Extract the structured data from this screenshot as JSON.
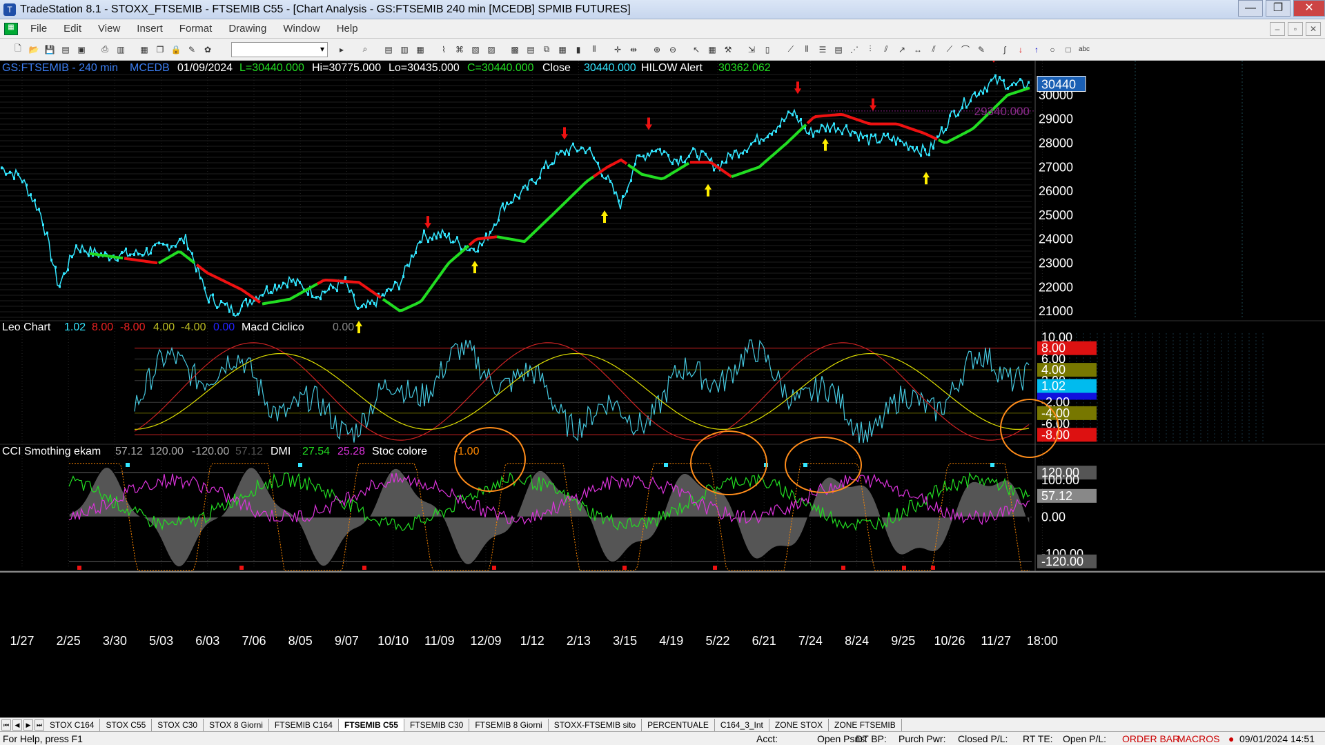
{
  "window": {
    "title": "TradeStation 8.1 - STOXX_FTSEMIB - FTSEMIB C55 - [Chart Analysis - GS:FTSEMIB  240 min  [MCEDB] SPMIB FUTURES]",
    "minimize": "—",
    "maximize": "❐",
    "close": "✕"
  },
  "menu": [
    "File",
    "Edit",
    "View",
    "Insert",
    "Format",
    "Drawing",
    "Window",
    "Help"
  ],
  "mdi_buttons": [
    "–",
    "▫",
    "✕"
  ],
  "toolbar": {
    "icons": [
      "new-doc",
      "open",
      "save",
      "save-all",
      "open-folder",
      "sep",
      "print",
      "print-preview",
      "sep",
      "window-tile",
      "window-cascade",
      "lock",
      "paint",
      "objects",
      "sep",
      "symbol-dropdown",
      "arrow-right",
      "sep",
      "find",
      "sep",
      "format-1",
      "format-2",
      "format-3",
      "sep",
      "chart-1",
      "chart-2",
      "chart-3",
      "chart-4",
      "sep",
      "grid-1",
      "grid-2",
      "bar-1",
      "bar-2",
      "bar-3",
      "bar-4",
      "sep",
      "crosshair",
      "bars",
      "sep",
      "zoom-in",
      "zoom-out",
      "sep",
      "pointer",
      "data-window",
      "tools",
      "sep",
      "export",
      "export-2",
      "sep",
      "trendline",
      "vlines",
      "hlines",
      "retrace",
      "fan",
      "fib-time",
      "channel",
      "ray",
      "extend",
      "parallel",
      "speed",
      "arc",
      "pen",
      "sep",
      "curve",
      "arrow-down-red",
      "arrow-up-blue",
      "ellipse",
      "rectangle",
      "text"
    ],
    "text_tool_label": "abc"
  },
  "header": {
    "symbol": "GS:FTSEMIB - 240 min",
    "source": "MCEDB",
    "date": "01/09/2024",
    "last": "L=30440.000",
    "high": "Hi=30775.000",
    "low": "Lo=30435.000",
    "close": "C=30440.000",
    "close_label": "Close",
    "close_value": "30440.000",
    "hilow_label": "HILOW Alert",
    "hilow_value": "30362.062"
  },
  "price_panel": {
    "y_ticks": [
      "30000",
      "29000",
      "28000",
      "27000",
      "26000",
      "25000",
      "24000",
      "23000",
      "22000",
      "21000"
    ],
    "last_price_tag": "30440",
    "alert_line_label": "29340.000"
  },
  "leo_panel": {
    "title": "Leo Chart",
    "values": [
      "1.02",
      "8.00",
      "-8.00",
      "4.00",
      "-4.00",
      "0.00"
    ],
    "macd_label": "Macd Ciclico",
    "macd_value": "0.00",
    "y_ticks": [
      "10.00",
      "8.00",
      "6.00",
      "4.00",
      "2.00",
      "1.02",
      "-2.00",
      "-4.00",
      "-6.00",
      "-8.00"
    ]
  },
  "cci_panel": {
    "title": "CCI Smothing ekam",
    "values": [
      "57.12",
      "120.00",
      "-120.00",
      "57.12"
    ],
    "dmi_label": "DMI",
    "dmi_values": [
      "27.54",
      "25.28"
    ],
    "stoc_label": "Stoc colore",
    "stoc_value": "-1.00",
    "y_ticks": [
      "120.00",
      "100.00",
      "57.12",
      "0.00",
      "-100.00",
      "-120.00"
    ]
  },
  "x_axis": {
    "labels": [
      "1/27",
      "2/25",
      "3/30",
      "5/03",
      "6/03",
      "7/06",
      "8/05",
      "9/07",
      "10/10",
      "11/09",
      "12/09",
      "1/12",
      "2/13",
      "3/15",
      "4/19",
      "5/22",
      "6/21",
      "7/24",
      "8/24",
      "9/25",
      "10/26",
      "11/27",
      "18:00"
    ]
  },
  "colors": {
    "price": "#33e6ff",
    "ma_up": "#22dd22",
    "ma_down": "#ee1111",
    "arrow_up": "#ffee00",
    "arrow_down": "#ee1111",
    "leo_cyan": "#46c9e0",
    "leo_red": "#cc2222",
    "leo_yellow": "#dddd00",
    "cci_fill": "#555555",
    "dmi_green": "#22dd22",
    "dmi_magenta": "#dd33dd",
    "stoc_orange": "#ff8800",
    "circle": "#ff8c1a"
  },
  "tabs": [
    "STOX C164",
    "STOX C55",
    "STOX  C30",
    "STOX  8 Giorni",
    "FTSEMIB C164",
    "FTSEMIB C55",
    "FTSEMIB C30",
    "FTSEMIB  8 Giorni",
    "STOXX-FTSEMIB sito",
    "PERCENTUALE",
    "C164_3_Int",
    "ZONE STOX",
    "ZONE FTSEMIB"
  ],
  "active_tab": "FTSEMIB C55",
  "status": {
    "help": "For Help, press F1",
    "acct": "Acct:",
    "open_psns": "Open Psns:",
    "dt_bp": "DT BP:",
    "purch_pwr": "Purch Pwr:",
    "closed_pl": "Closed P/L:",
    "rt_te": "RT TE:",
    "open_pl": "Open P/L:",
    "order_bar": "ORDER BAR",
    "macros": "MACROS",
    "datetime": "09/01/2024 14:51"
  }
}
